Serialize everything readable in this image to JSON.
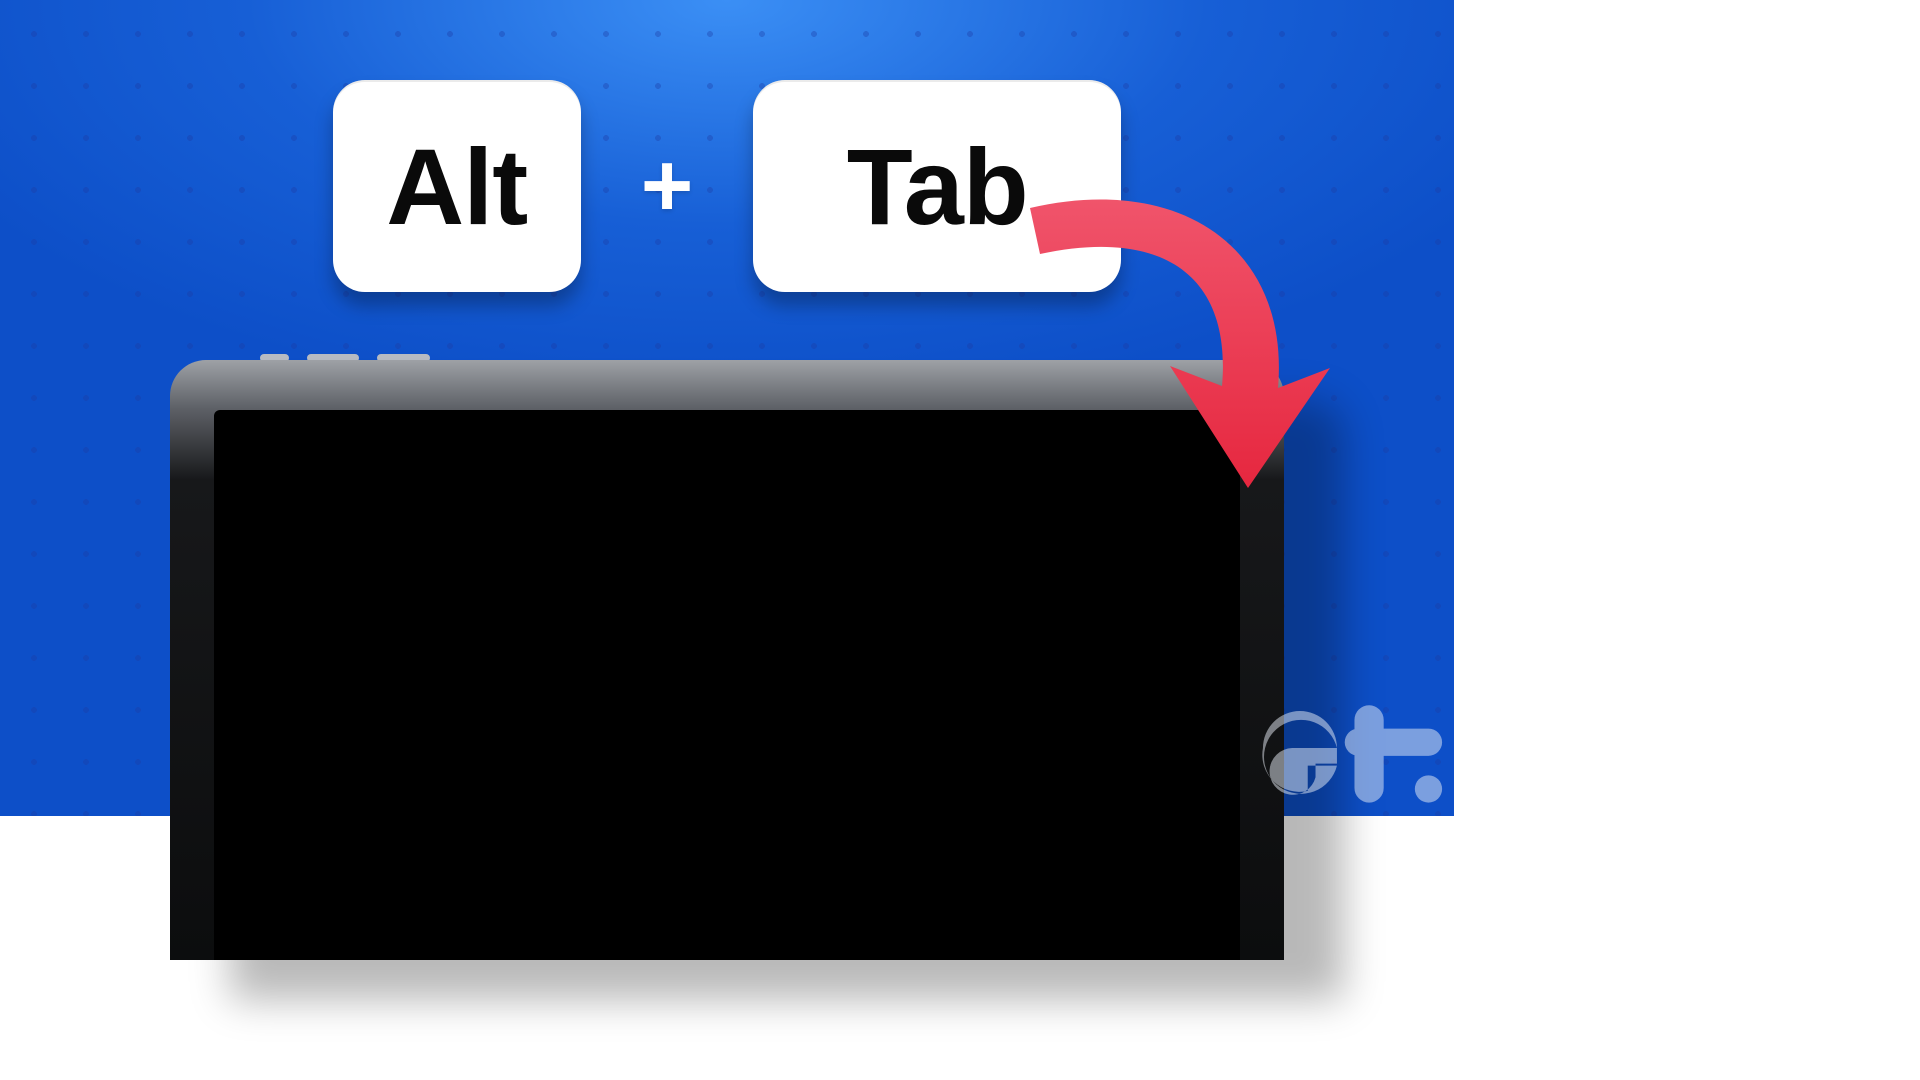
{
  "keys": {
    "left": "Alt",
    "plus": "+",
    "right": "Tab"
  },
  "colors": {
    "arrow": "#ef3d54",
    "bg_center": "#3b8ff5",
    "bg_edge": "#0d4fc8",
    "key_bg": "#ffffff",
    "key_text": "#0a0a0a"
  },
  "watermark_name": "gt-logo"
}
